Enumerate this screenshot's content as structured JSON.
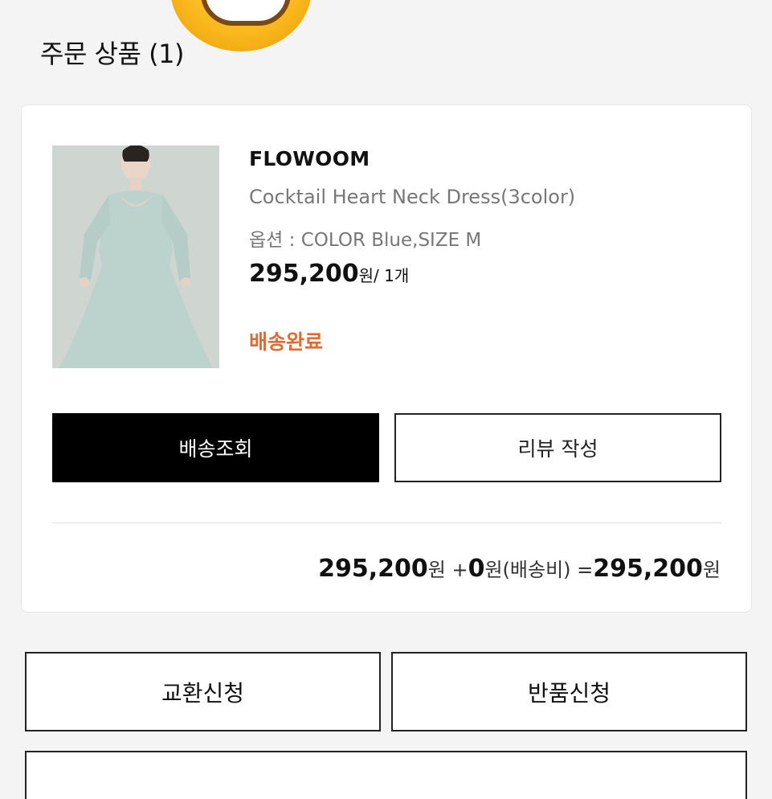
{
  "header": {
    "title": "주문 상품 (1)"
  },
  "order_item": {
    "brand": "FLOWOOM",
    "product_name": "Cocktail Heart Neck Dress(3color)",
    "option": "옵션 : COLOR Blue,SIZE M",
    "price": "295,200",
    "price_unit": "원/ 1개",
    "status": "배송완료",
    "status_color": "#e06a33"
  },
  "actions": {
    "track_label": "배송조회",
    "review_label": "리뷰 작성"
  },
  "summary": {
    "item_price": "295,200",
    "won1": "원",
    "plus": " +",
    "shipping_fee": "0",
    "shipping_label": "원(배송비)",
    "equals": " =",
    "total": "295,200",
    "won2": "원"
  },
  "bottom_actions": {
    "exchange_label": "교환신청",
    "return_label": "반품신청"
  }
}
